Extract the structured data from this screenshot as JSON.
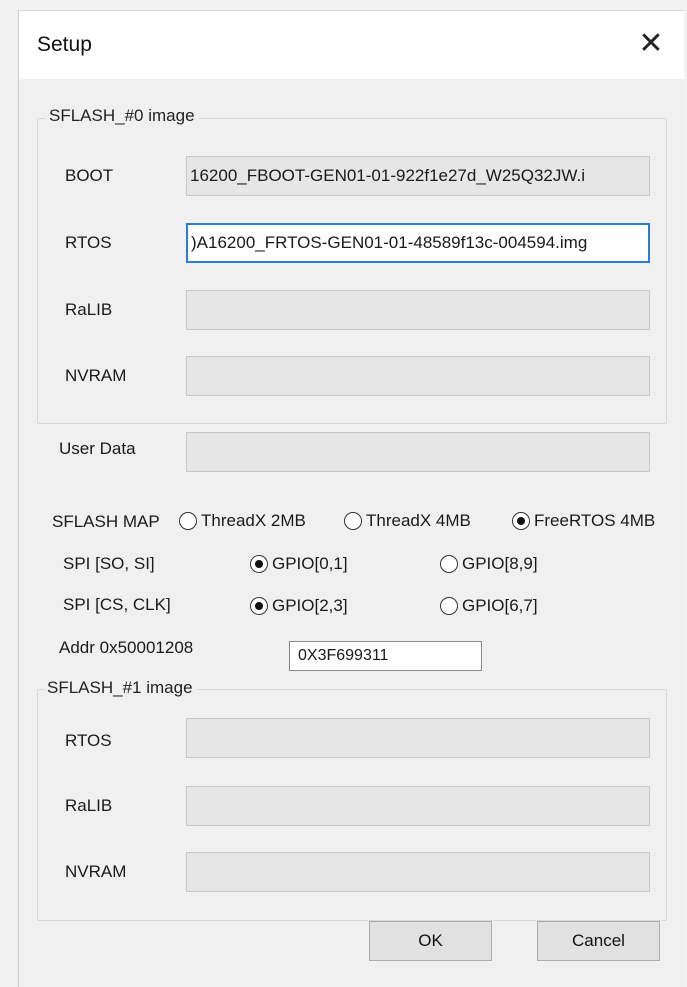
{
  "window": {
    "title": "Setup"
  },
  "group0": {
    "legend": "SFLASH_#0 image",
    "rows": [
      {
        "label": "BOOT",
        "value": "16200_FBOOT-GEN01-01-922f1e27d_W25Q32JW.i"
      },
      {
        "label": "RTOS",
        "value": ")A16200_FRTOS-GEN01-01-48589f13c-004594.img"
      },
      {
        "label": "RaLIB",
        "value": ""
      },
      {
        "label": "NVRAM",
        "value": ""
      }
    ]
  },
  "user_data": {
    "label": "User Data",
    "value": ""
  },
  "sflash_map": {
    "label": "SFLASH MAP",
    "options": [
      "ThreadX 2MB",
      "ThreadX 4MB",
      "FreeRTOS 4MB"
    ],
    "selected": "FreeRTOS 4MB"
  },
  "spi_so_si": {
    "label": "SPI [SO, SI]",
    "options": [
      "GPIO[0,1]",
      "GPIO[8,9]"
    ],
    "selected": "GPIO[0,1]"
  },
  "spi_cs_clk": {
    "label": "SPI [CS, CLK]",
    "options": [
      "GPIO[2,3]",
      "GPIO[6,7]"
    ],
    "selected": "GPIO[2,3]"
  },
  "addr": {
    "label": "Addr 0x50001208",
    "value": "0X3F699311"
  },
  "group1": {
    "legend": "SFLASH_#1 image",
    "rows": [
      {
        "label": "RTOS",
        "value": ""
      },
      {
        "label": "RaLIB",
        "value": ""
      },
      {
        "label": "NVRAM",
        "value": ""
      }
    ]
  },
  "buttons": {
    "ok": "OK",
    "cancel": "Cancel"
  },
  "icons": {
    "close": "close-icon"
  },
  "colors": {
    "focus_border": "#2b7bd6",
    "field_bg": "#e6e6e6",
    "dialog_bg": "#f0f0f0"
  }
}
